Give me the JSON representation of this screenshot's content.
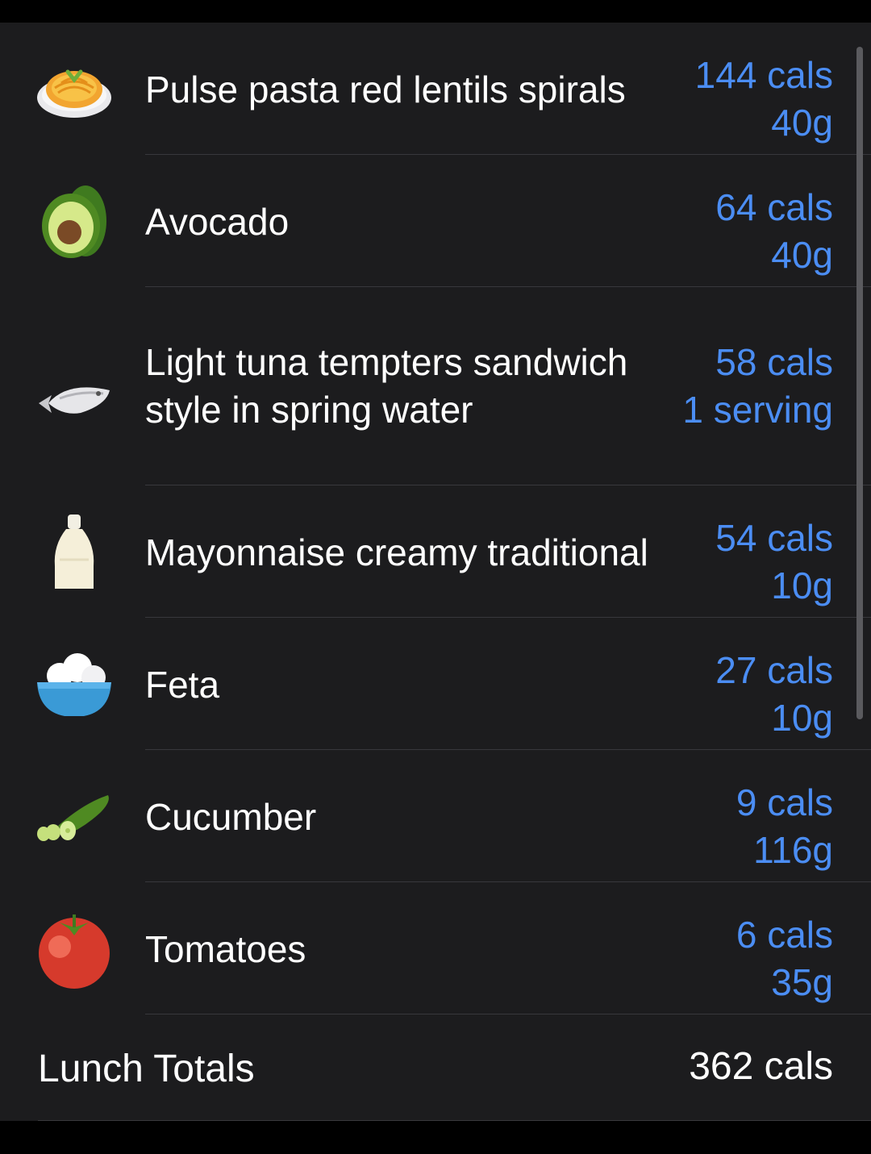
{
  "entries": [
    {
      "name": "Pulse pasta red lentils spirals",
      "cals": "144 cals",
      "amount": "40g",
      "icon": "pasta-icon"
    },
    {
      "name": "Avocado",
      "cals": "64 cals",
      "amount": "40g",
      "icon": "avocado-icon"
    },
    {
      "name": "Light tuna tempters sandwich style in spring water",
      "cals": "58 cals",
      "amount": "1 serving",
      "icon": "fish-icon"
    },
    {
      "name": "Mayonnaise creamy traditional",
      "cals": "54 cals",
      "amount": "10g",
      "icon": "bottle-icon"
    },
    {
      "name": "Feta",
      "cals": "27 cals",
      "amount": "10g",
      "icon": "bowl-icon"
    },
    {
      "name": "Cucumber",
      "cals": "9 cals",
      "amount": "116g",
      "icon": "cucumber-icon"
    },
    {
      "name": "Tomatoes",
      "cals": "6 cals",
      "amount": "35g",
      "icon": "tomato-icon"
    }
  ],
  "totals": {
    "label": "Lunch Totals",
    "value": "362 cals"
  },
  "colors": {
    "background": "#1c1c1e",
    "accent": "#4b8df3",
    "text": "#ffffff",
    "separator": "#38383c"
  }
}
